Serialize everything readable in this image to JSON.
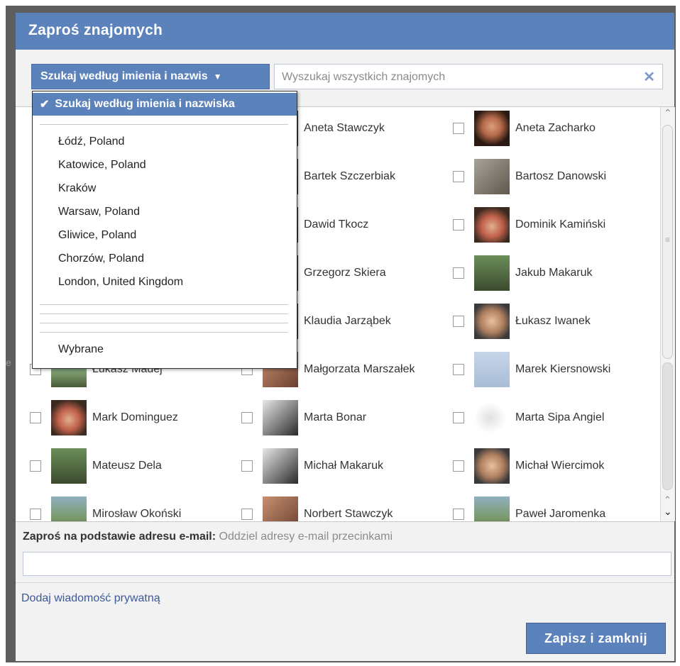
{
  "dialog": {
    "title": "Zaproś znajomych"
  },
  "filter": {
    "button_label": "Szukaj według imienia i nazwis"
  },
  "search": {
    "placeholder": "Wyszukaj wszystkich znajomych"
  },
  "dropdown": {
    "selected": "Szukaj według imienia i nazwiska",
    "locations": [
      "Łódź, Poland",
      "Katowice, Poland",
      "Kraków",
      "Warsaw, Poland",
      "Gliwice, Poland",
      "Chorzów, Poland",
      "London, United Kingdom"
    ],
    "footer_item": "Wybrane"
  },
  "friends": [
    {
      "name": "Aneta Stawczyk",
      "col": 1,
      "row": 0,
      "avatar": "dark"
    },
    {
      "name": "Aneta Zacharko",
      "col": 2,
      "row": 0,
      "avatar": "woman"
    },
    {
      "name": "Bartek Szczerbiak",
      "col": 1,
      "row": 1,
      "avatar": "dark"
    },
    {
      "name": "Bartosz Danowski",
      "col": 2,
      "row": 1,
      "avatar": "grey"
    },
    {
      "name": "Dawid Tkocz",
      "col": 1,
      "row": 2,
      "avatar": "dark"
    },
    {
      "name": "Dominik Kamiński",
      "col": 2,
      "row": 2,
      "avatar": "red"
    },
    {
      "name": "Grzegorz Skiera",
      "col": 1,
      "row": 3,
      "avatar": "dark"
    },
    {
      "name": "Jakub Makaruk",
      "col": 2,
      "row": 3,
      "avatar": "green"
    },
    {
      "name": "Klaudia Jarząbek",
      "col": 1,
      "row": 4,
      "avatar": "dark"
    },
    {
      "name": "Łukasz Iwanek",
      "col": 2,
      "row": 4,
      "avatar": "face"
    },
    {
      "name": "Łukasz Madej",
      "col": 0,
      "row": 5,
      "avatar": "outdoor"
    },
    {
      "name": "Małgorzata Marszałek",
      "col": 1,
      "row": 5,
      "avatar": "warm"
    },
    {
      "name": "Marek Kiersnowski",
      "col": 2,
      "row": 5,
      "avatar": "placeholder"
    },
    {
      "name": "Mark Dominguez",
      "col": 0,
      "row": 6,
      "avatar": "red"
    },
    {
      "name": "Marta Bonar",
      "col": 1,
      "row": 6,
      "avatar": "bw"
    },
    {
      "name": "Marta Sipa Angiel",
      "col": 2,
      "row": 6,
      "avatar": "white"
    },
    {
      "name": "Mateusz Dela",
      "col": 0,
      "row": 7,
      "avatar": "green"
    },
    {
      "name": "Michał Makaruk",
      "col": 1,
      "row": 7,
      "avatar": "bw"
    },
    {
      "name": "Michał Wiercimok",
      "col": 2,
      "row": 7,
      "avatar": "face"
    },
    {
      "name": "Mirosław Okoński",
      "col": 0,
      "row": 8,
      "avatar": "outdoor"
    },
    {
      "name": "Norbert Stawczyk",
      "col": 1,
      "row": 8,
      "avatar": "warm"
    },
    {
      "name": "Paweł Jaromenka",
      "col": 2,
      "row": 8,
      "avatar": "outdoor"
    }
  ],
  "email": {
    "label": "Zaproś na podstawie adresu e-mail:",
    "hint": "Oddziel adresy e-mail przecinkami"
  },
  "message": {
    "link": "Dodaj wiadomość prywatną"
  },
  "footer": {
    "save_label": "Zapisz i zamknij"
  },
  "colors": {
    "accent": "#5b82bb",
    "link": "#3b5998"
  },
  "icons": {
    "clear": "close-icon",
    "caret": "triangle-down-icon",
    "check": "checkmark-icon"
  },
  "scrollbar_position": 0.0
}
